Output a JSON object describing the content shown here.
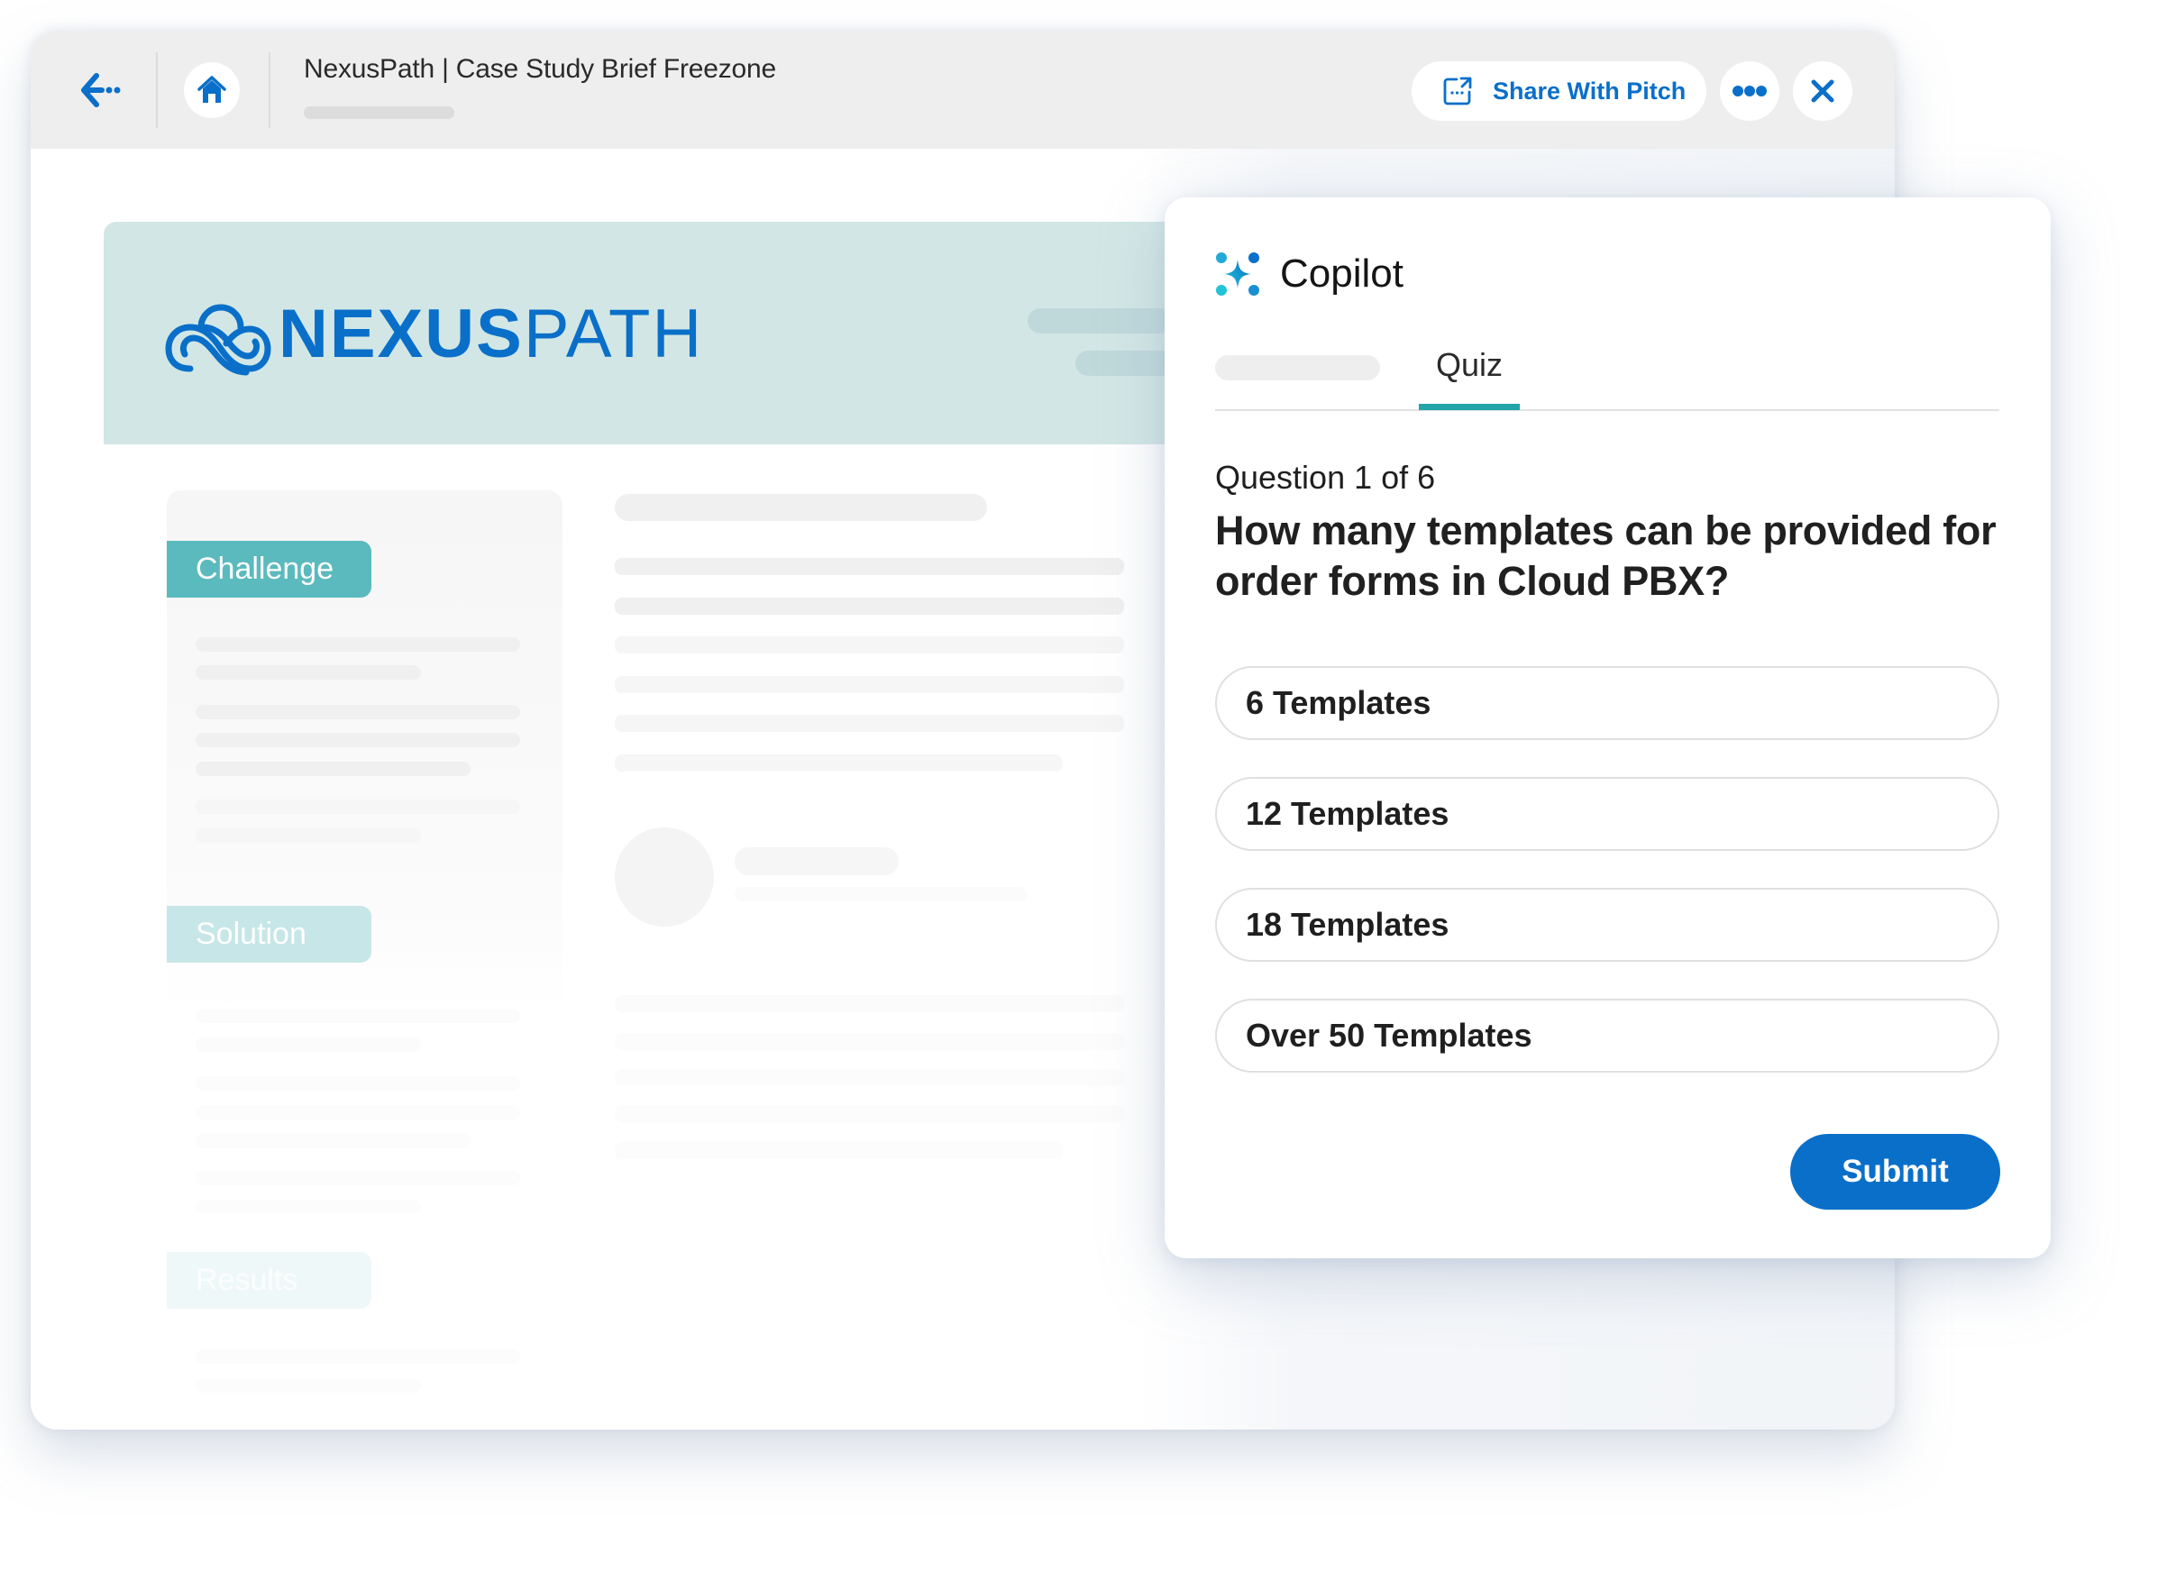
{
  "window": {
    "title": "NexusPath | Case Study Brief Freezone",
    "share_button_label": "Share With Pitch",
    "icons": {
      "back": "back-arrow-icon",
      "home": "home-icon",
      "share": "share-icon",
      "more": "more-horizontal-icon",
      "close": "close-icon"
    }
  },
  "document": {
    "brand": {
      "bold": "NEXUS",
      "light": "PATH"
    },
    "sections": [
      "Challenge",
      "Solution",
      "Results"
    ]
  },
  "copilot": {
    "title": "Copilot",
    "icon": "sparkle-icon",
    "tabs": [
      {
        "label": "",
        "active": false
      },
      {
        "label": "Quiz",
        "active": true
      }
    ],
    "question_counter": "Question 1 of 6",
    "question": "How many templates can be provided for order forms in Cloud PBX?",
    "options": [
      "6 Templates",
      "12 Templates",
      "18 Templates",
      "Over 50 Templates"
    ],
    "submit_label": "Submit"
  },
  "colors": {
    "brand_blue": "#0a6fc9",
    "teal_accent": "#22a4a8",
    "banner_bg": "#d2e7e5",
    "challenge_tag": "#5bbabd"
  }
}
